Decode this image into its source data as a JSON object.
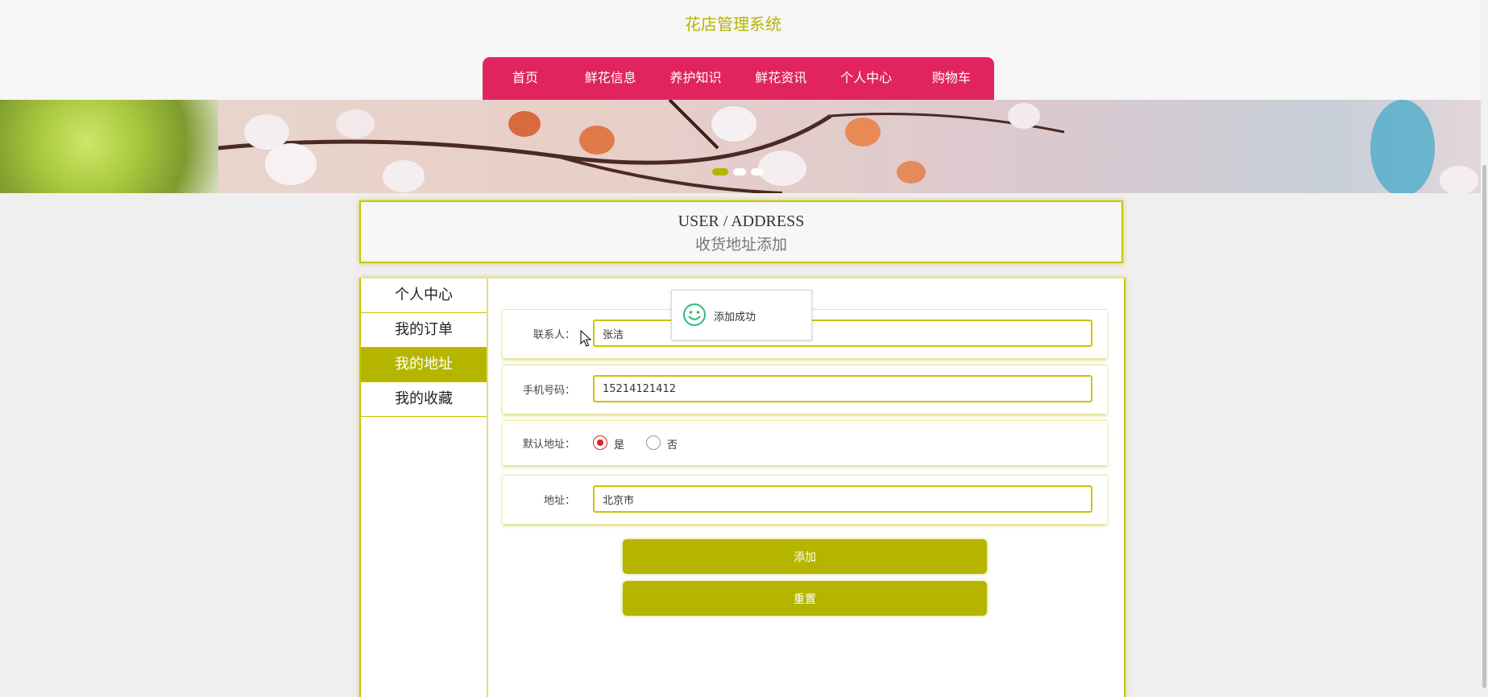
{
  "site": {
    "title": "花店管理系统"
  },
  "nav": {
    "items": [
      "首页",
      "鲜花信息",
      "养护知识",
      "鲜花资讯",
      "个人中心",
      "购物车"
    ]
  },
  "banner": {
    "slides": 3,
    "active_slide": 1
  },
  "heading": {
    "en": "USER / ADDRESS",
    "cn": "收货地址添加"
  },
  "sidebar": {
    "items": [
      "个人中心",
      "我的订单",
      "我的地址",
      "我的收藏"
    ],
    "active": "我的地址"
  },
  "form": {
    "contact": {
      "label": "联系人：",
      "value": "张洁"
    },
    "phone": {
      "label": "手机号码：",
      "value": "15214121412"
    },
    "default_address": {
      "label": "默认地址：",
      "options": [
        "是",
        "否"
      ],
      "selected": "是"
    },
    "address": {
      "label": "地址：",
      "value": "北京市"
    },
    "submit_label": "添加",
    "reset_label": "重置"
  },
  "toast": {
    "message": "添加成功",
    "icon": "smiley-icon"
  },
  "colors": {
    "accent": "#b5b500",
    "nav": "#e1245f",
    "radio": "#d9241f",
    "toast_icon": "#2dbb7c"
  }
}
